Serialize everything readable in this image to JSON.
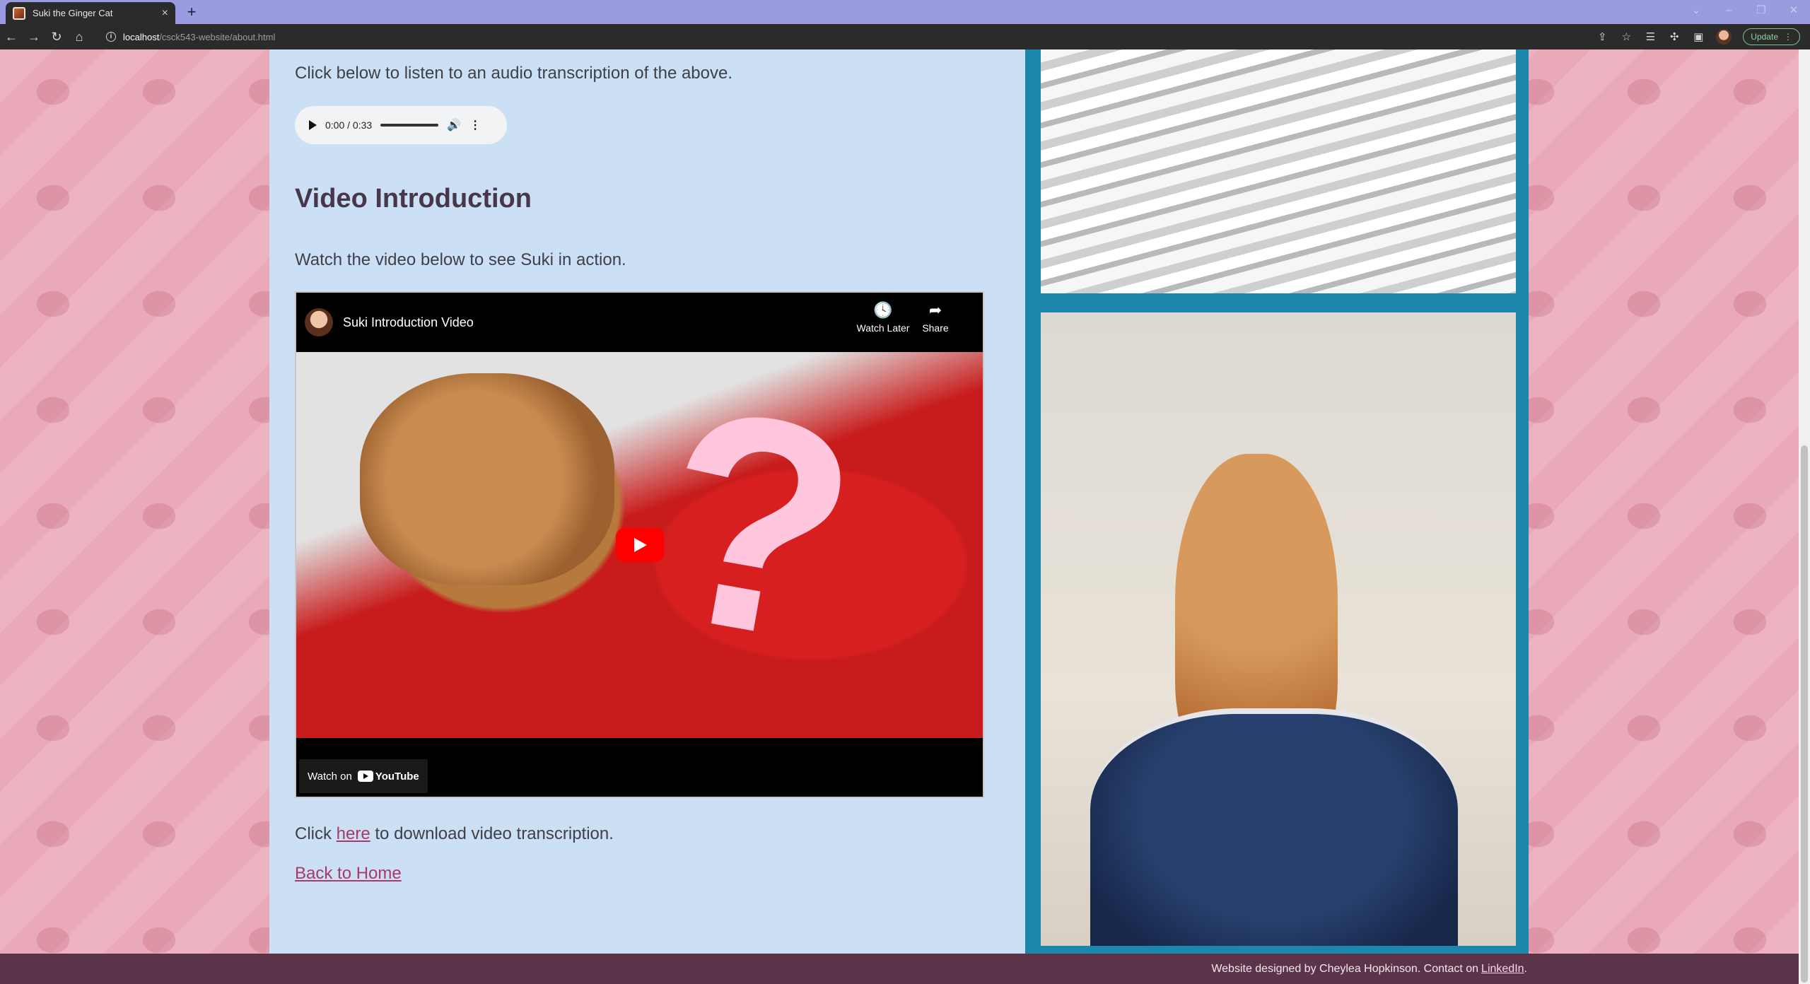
{
  "browser": {
    "tab_title": "Suki the Ginger Cat",
    "tab_close": "×",
    "new_tab": "+",
    "url_host": "localhost",
    "url_path": "/csck543-website/about.html",
    "update_label": "Update",
    "icons": [
      "back-icon",
      "forward-icon",
      "reload-icon",
      "home-icon",
      "info-icon",
      "share-icon",
      "bookmark-star-icon",
      "reading-list-icon",
      "extensions-icon",
      "side-panel-icon",
      "profile-avatar",
      "more-icon"
    ]
  },
  "content": {
    "audio_prompt": "Click below to listen to an audio transcription of the above.",
    "audio": {
      "time": "0:00 / 0:33"
    },
    "video_heading": "Video Introduction",
    "video_prompt": "Watch the video below to see Suki in action.",
    "video": {
      "title": "Suki Introduction Video",
      "watch_later": "Watch Later",
      "share": "Share",
      "watch_on": "Watch on",
      "youtube": "YouTube"
    },
    "transcription": {
      "before": "Click ",
      "link": "here",
      "after": " to download video transcription."
    },
    "back_link": "Back to Home"
  },
  "footer": {
    "text": "Website designed by Cheylea Hopkinson. Contact on ",
    "link": "LinkedIn",
    "end": "."
  },
  "colors": {
    "main_bg": "#cce0f5",
    "side_bg": "#1c86ad",
    "footer_bg": "#5b3449",
    "link": "#a83a6a",
    "tabbar": "#9b9ce0"
  }
}
